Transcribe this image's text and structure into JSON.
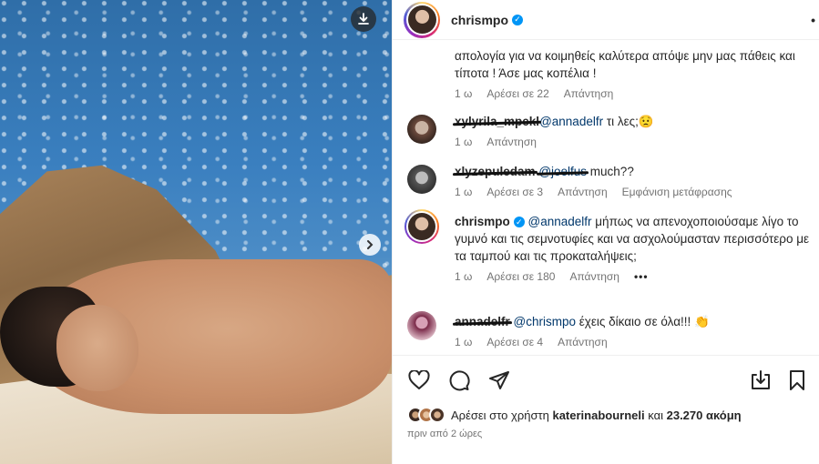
{
  "post": {
    "author": "chrismpo",
    "more_label": "•"
  },
  "comments": [
    {
      "text": "απολογία για να κοιμηθείς καλύτερα απόψε μην μας πάθεις και τίποτα ! Άσε μας κοπέλια !",
      "time": "1 ω",
      "likes": "Αρέσει σε 22",
      "reply": "Απάντηση"
    },
    {
      "user": "xylyrila_mpekl",
      "mention": "@annadelfr",
      "text": " τι λες;😟",
      "time": "1 ω",
      "reply": "Απάντηση"
    },
    {
      "user": "xlyzepuledam",
      "mention": "@joelfus",
      "text": " much??",
      "time": "1 ω",
      "likes": "Αρέσει σε 3",
      "reply": "Απάντηση",
      "translate": "Εμφάνιση μετάφρασης"
    },
    {
      "user": "chrismpo",
      "mention": "@annadelfr",
      "text": " μήπως να απενοχοποιούσαμε λίγο το γυμνό και τις σεμνοτυφίες και να ασχολούμασταν περισσότερο με τα ταμπού και τις προκαταλήψεις;",
      "time": "1 ω",
      "likes": "Αρέσει σε 180",
      "reply": "Απάντηση",
      "more": "•••"
    },
    {
      "user": "annadelfr",
      "mention": "@chrismpo",
      "text": " έχεις δίκαιο σε όλα!!! 👏",
      "time": "1 ω",
      "likes": "Αρέσει σε 4",
      "reply": "Απάντηση"
    }
  ],
  "footer": {
    "likes_prefix": "Αρέσει στο χρήστη",
    "likes_user": "katerinabourneli",
    "likes_and": "και",
    "likes_count": "23.270 ακόμη",
    "time": "πριν από 2 ώρες"
  },
  "icons": {
    "download": "download-icon",
    "next": "chevron-right-icon",
    "like": "heart-icon",
    "comment": "comment-icon",
    "share": "send-icon",
    "save": "bookmark-icon"
  }
}
